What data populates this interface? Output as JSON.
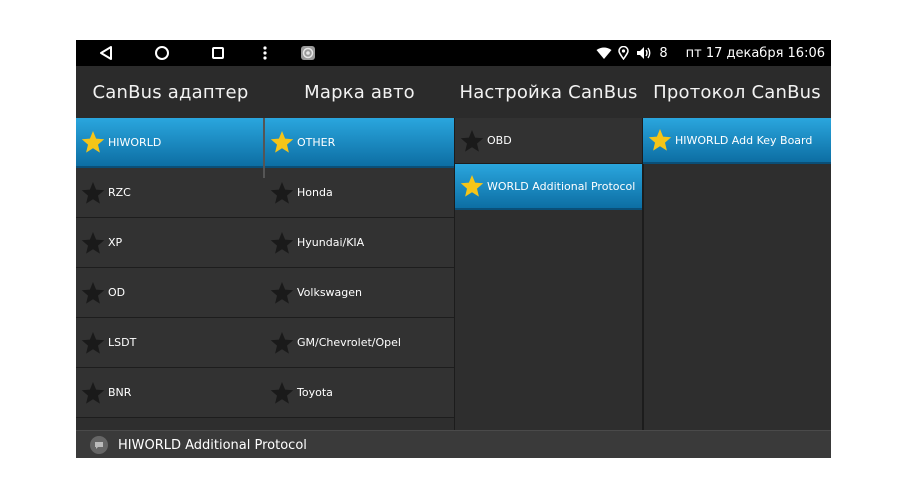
{
  "statusbar": {
    "volume": "8",
    "datetime": "пт 17 декабря 16:06"
  },
  "header": {
    "tabs": [
      {
        "label": "CanBus адаптер"
      },
      {
        "label": "Марка авто"
      },
      {
        "label": "Настройка CanBus"
      },
      {
        "label": "Протокол CanBus"
      }
    ]
  },
  "adapters": [
    {
      "label": "HIWORLD",
      "selected": true
    },
    {
      "label": "RZC",
      "selected": false
    },
    {
      "label": "XP",
      "selected": false
    },
    {
      "label": "OD",
      "selected": false
    },
    {
      "label": "LSDT",
      "selected": false
    },
    {
      "label": "BNR",
      "selected": false
    }
  ],
  "brands": [
    {
      "label": "OTHER",
      "selected": true
    },
    {
      "label": "Honda",
      "selected": false
    },
    {
      "label": "Hyundai/KIA",
      "selected": false
    },
    {
      "label": "Volkswagen",
      "selected": false
    },
    {
      "label": "GM/Chevrolet/Opel",
      "selected": false
    },
    {
      "label": "Toyota",
      "selected": false
    }
  ],
  "settings": [
    {
      "label": "OBD",
      "selected": false
    },
    {
      "label": "WORLD Additional Protocol",
      "selected": true
    }
  ],
  "protocols": [
    {
      "label": "HIWORLD Add Key Board",
      "selected": true
    }
  ],
  "bottombar": {
    "text": "HIWORLD Additional Protocol"
  },
  "colors": {
    "selected_gradient_top": "#2aa6de",
    "selected_gradient_bottom": "#0d6ea3",
    "star_active": "#f5c518",
    "star_inactive": "#1a1a1a",
    "panel_bg": "#2e2e2e"
  },
  "icons": {
    "back": "back-triangle-icon",
    "home": "home-circle-icon",
    "recent": "recent-square-icon",
    "menu": "more-vert-icon",
    "app": "app-gear-icon",
    "wifi": "wifi-icon",
    "location": "location-pin-icon",
    "volume": "volume-icon",
    "star": "star-icon",
    "notification": "notification-bubble-icon"
  }
}
